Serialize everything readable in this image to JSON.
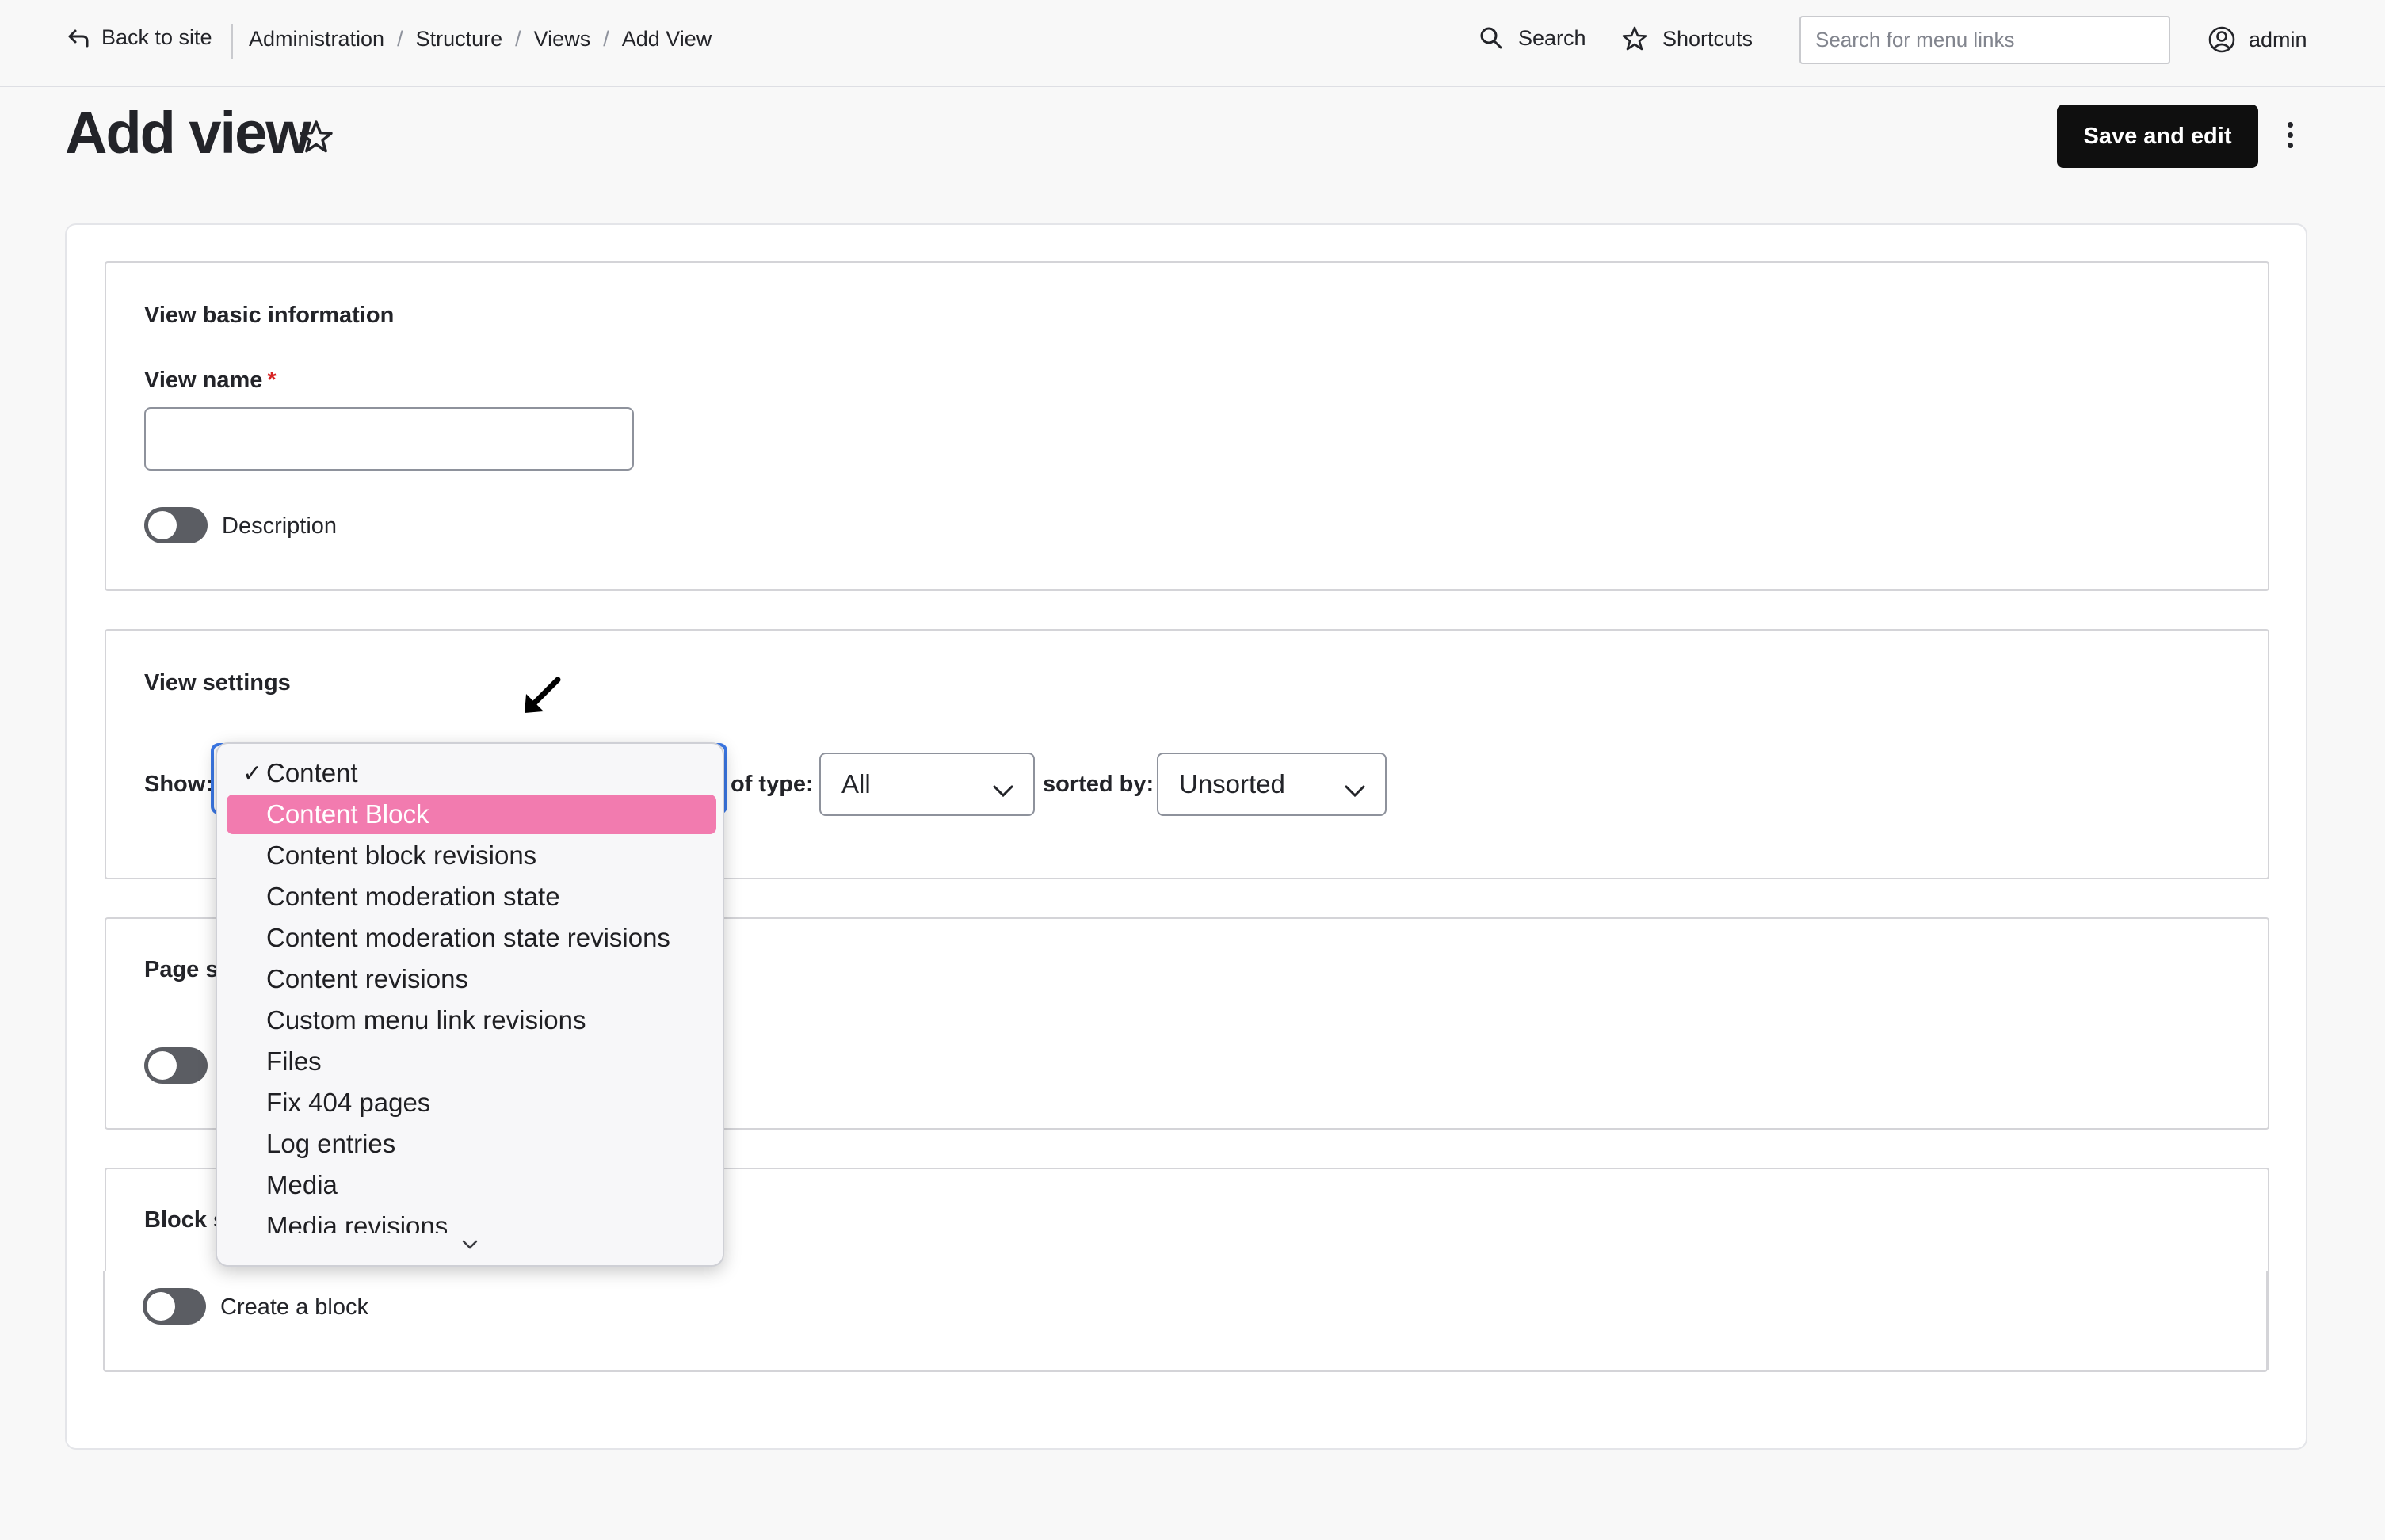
{
  "toolbar": {
    "back_label": "Back to site",
    "breadcrumbs": [
      "Administration",
      "Structure",
      "Views",
      "Add View"
    ],
    "search_label": "Search",
    "shortcuts_label": "Shortcuts",
    "menu_search_placeholder": "Search for menu links",
    "user_label": "admin"
  },
  "page": {
    "title": "Add view",
    "save_button": "Save and edit"
  },
  "basic_info": {
    "legend": "View basic information",
    "view_name_label": "View name",
    "required_mark": "*",
    "view_name_value": "",
    "description_toggle_label": "Description"
  },
  "view_settings": {
    "legend": "View settings",
    "show_label": "Show:",
    "of_type_label": "of type:",
    "of_type_value": "All",
    "sorted_by_label": "sorted by:",
    "sorted_by_value": "Unsorted"
  },
  "page_settings": {
    "legend": "Page s"
  },
  "block_settings": {
    "legend": "Block s",
    "create_block_label": "Create a block"
  },
  "show_dropdown": {
    "checked_item": "Content",
    "highlighted_item": "Content Block",
    "options": [
      "Content",
      "Content Block",
      "Content block revisions",
      "Content moderation state",
      "Content moderation state revisions",
      "Content revisions",
      "Custom menu link revisions",
      "Files",
      "Fix 404 pages",
      "Log entries",
      "Media",
      "Media revisions"
    ]
  },
  "colors": {
    "highlight": "#f27baf",
    "focus_ring": "#3b78e7",
    "primary_button": "#0f0f0f",
    "required": "#d72222"
  }
}
